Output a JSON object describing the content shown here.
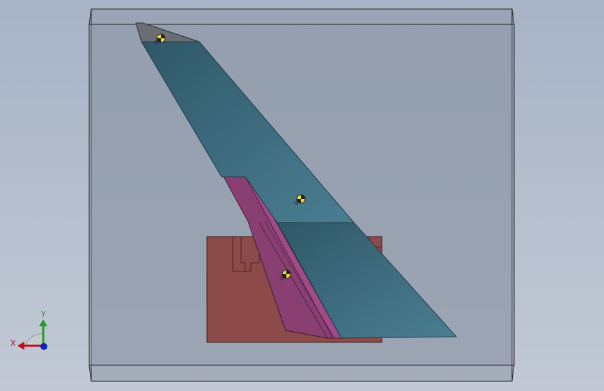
{
  "triad": {
    "x_label": "X",
    "y_label": "Y",
    "x_color": "#c0101a",
    "y_color": "#18a018",
    "z_color": "#1020c0"
  },
  "colors": {
    "background_top": "#a7b3c6",
    "background_bottom": "#c2c9d5",
    "transparent_box": "#8e98a6",
    "wing_panel": "#3f6d80",
    "wing_panel_dark": "#2f5868",
    "tip_cap": "#6b6e74",
    "flap_panel": "#8a3f73",
    "base_block": "#8c4a48",
    "center_of_mass_marker": "#f0e020"
  },
  "scene": {
    "component_names": [
      "tail-fin",
      "rudder-flap",
      "mounting-block",
      "bounding-box"
    ],
    "markers": [
      "center-of-mass-icon",
      "center-of-mass-icon",
      "center-of-mass-icon"
    ]
  }
}
